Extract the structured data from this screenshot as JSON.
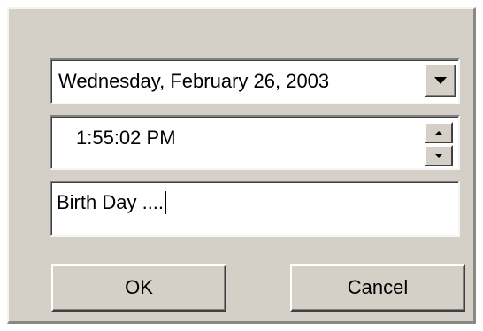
{
  "dialog": {
    "date_value": "Wednesday,  February  26, 2003",
    "time_value": "1:55:02 PM",
    "note_value": "Birth Day ....",
    "ok_label": "OK",
    "cancel_label": "Cancel"
  },
  "icons": {
    "date_dropdown": "chevron-down-icon",
    "spin_up": "spin-up-icon",
    "spin_down": "spin-down-icon"
  },
  "colors": {
    "face": "#d4d0c8",
    "field": "#ffffff"
  }
}
